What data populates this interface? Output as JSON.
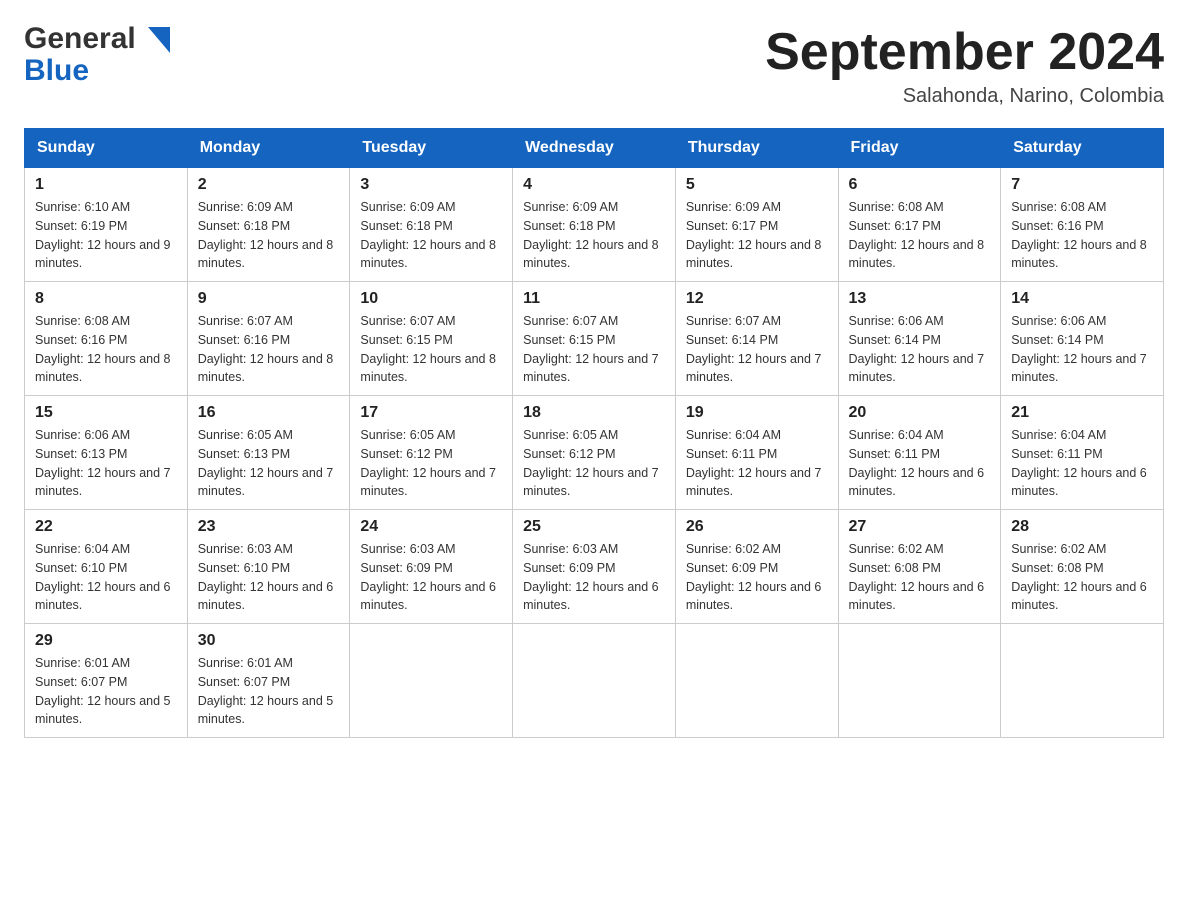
{
  "header": {
    "title": "September 2024",
    "location": "Salahonda, Narino, Colombia",
    "logo_general": "General",
    "logo_blue": "Blue"
  },
  "weekdays": [
    "Sunday",
    "Monday",
    "Tuesday",
    "Wednesday",
    "Thursday",
    "Friday",
    "Saturday"
  ],
  "weeks": [
    [
      {
        "day": "1",
        "sunrise": "Sunrise: 6:10 AM",
        "sunset": "Sunset: 6:19 PM",
        "daylight": "Daylight: 12 hours and 9 minutes."
      },
      {
        "day": "2",
        "sunrise": "Sunrise: 6:09 AM",
        "sunset": "Sunset: 6:18 PM",
        "daylight": "Daylight: 12 hours and 8 minutes."
      },
      {
        "day": "3",
        "sunrise": "Sunrise: 6:09 AM",
        "sunset": "Sunset: 6:18 PM",
        "daylight": "Daylight: 12 hours and 8 minutes."
      },
      {
        "day": "4",
        "sunrise": "Sunrise: 6:09 AM",
        "sunset": "Sunset: 6:18 PM",
        "daylight": "Daylight: 12 hours and 8 minutes."
      },
      {
        "day": "5",
        "sunrise": "Sunrise: 6:09 AM",
        "sunset": "Sunset: 6:17 PM",
        "daylight": "Daylight: 12 hours and 8 minutes."
      },
      {
        "day": "6",
        "sunrise": "Sunrise: 6:08 AM",
        "sunset": "Sunset: 6:17 PM",
        "daylight": "Daylight: 12 hours and 8 minutes."
      },
      {
        "day": "7",
        "sunrise": "Sunrise: 6:08 AM",
        "sunset": "Sunset: 6:16 PM",
        "daylight": "Daylight: 12 hours and 8 minutes."
      }
    ],
    [
      {
        "day": "8",
        "sunrise": "Sunrise: 6:08 AM",
        "sunset": "Sunset: 6:16 PM",
        "daylight": "Daylight: 12 hours and 8 minutes."
      },
      {
        "day": "9",
        "sunrise": "Sunrise: 6:07 AM",
        "sunset": "Sunset: 6:16 PM",
        "daylight": "Daylight: 12 hours and 8 minutes."
      },
      {
        "day": "10",
        "sunrise": "Sunrise: 6:07 AM",
        "sunset": "Sunset: 6:15 PM",
        "daylight": "Daylight: 12 hours and 8 minutes."
      },
      {
        "day": "11",
        "sunrise": "Sunrise: 6:07 AM",
        "sunset": "Sunset: 6:15 PM",
        "daylight": "Daylight: 12 hours and 7 minutes."
      },
      {
        "day": "12",
        "sunrise": "Sunrise: 6:07 AM",
        "sunset": "Sunset: 6:14 PM",
        "daylight": "Daylight: 12 hours and 7 minutes."
      },
      {
        "day": "13",
        "sunrise": "Sunrise: 6:06 AM",
        "sunset": "Sunset: 6:14 PM",
        "daylight": "Daylight: 12 hours and 7 minutes."
      },
      {
        "day": "14",
        "sunrise": "Sunrise: 6:06 AM",
        "sunset": "Sunset: 6:14 PM",
        "daylight": "Daylight: 12 hours and 7 minutes."
      }
    ],
    [
      {
        "day": "15",
        "sunrise": "Sunrise: 6:06 AM",
        "sunset": "Sunset: 6:13 PM",
        "daylight": "Daylight: 12 hours and 7 minutes."
      },
      {
        "day": "16",
        "sunrise": "Sunrise: 6:05 AM",
        "sunset": "Sunset: 6:13 PM",
        "daylight": "Daylight: 12 hours and 7 minutes."
      },
      {
        "day": "17",
        "sunrise": "Sunrise: 6:05 AM",
        "sunset": "Sunset: 6:12 PM",
        "daylight": "Daylight: 12 hours and 7 minutes."
      },
      {
        "day": "18",
        "sunrise": "Sunrise: 6:05 AM",
        "sunset": "Sunset: 6:12 PM",
        "daylight": "Daylight: 12 hours and 7 minutes."
      },
      {
        "day": "19",
        "sunrise": "Sunrise: 6:04 AM",
        "sunset": "Sunset: 6:11 PM",
        "daylight": "Daylight: 12 hours and 7 minutes."
      },
      {
        "day": "20",
        "sunrise": "Sunrise: 6:04 AM",
        "sunset": "Sunset: 6:11 PM",
        "daylight": "Daylight: 12 hours and 6 minutes."
      },
      {
        "day": "21",
        "sunrise": "Sunrise: 6:04 AM",
        "sunset": "Sunset: 6:11 PM",
        "daylight": "Daylight: 12 hours and 6 minutes."
      }
    ],
    [
      {
        "day": "22",
        "sunrise": "Sunrise: 6:04 AM",
        "sunset": "Sunset: 6:10 PM",
        "daylight": "Daylight: 12 hours and 6 minutes."
      },
      {
        "day": "23",
        "sunrise": "Sunrise: 6:03 AM",
        "sunset": "Sunset: 6:10 PM",
        "daylight": "Daylight: 12 hours and 6 minutes."
      },
      {
        "day": "24",
        "sunrise": "Sunrise: 6:03 AM",
        "sunset": "Sunset: 6:09 PM",
        "daylight": "Daylight: 12 hours and 6 minutes."
      },
      {
        "day": "25",
        "sunrise": "Sunrise: 6:03 AM",
        "sunset": "Sunset: 6:09 PM",
        "daylight": "Daylight: 12 hours and 6 minutes."
      },
      {
        "day": "26",
        "sunrise": "Sunrise: 6:02 AM",
        "sunset": "Sunset: 6:09 PM",
        "daylight": "Daylight: 12 hours and 6 minutes."
      },
      {
        "day": "27",
        "sunrise": "Sunrise: 6:02 AM",
        "sunset": "Sunset: 6:08 PM",
        "daylight": "Daylight: 12 hours and 6 minutes."
      },
      {
        "day": "28",
        "sunrise": "Sunrise: 6:02 AM",
        "sunset": "Sunset: 6:08 PM",
        "daylight": "Daylight: 12 hours and 6 minutes."
      }
    ],
    [
      {
        "day": "29",
        "sunrise": "Sunrise: 6:01 AM",
        "sunset": "Sunset: 6:07 PM",
        "daylight": "Daylight: 12 hours and 5 minutes."
      },
      {
        "day": "30",
        "sunrise": "Sunrise: 6:01 AM",
        "sunset": "Sunset: 6:07 PM",
        "daylight": "Daylight: 12 hours and 5 minutes."
      },
      null,
      null,
      null,
      null,
      null
    ]
  ]
}
